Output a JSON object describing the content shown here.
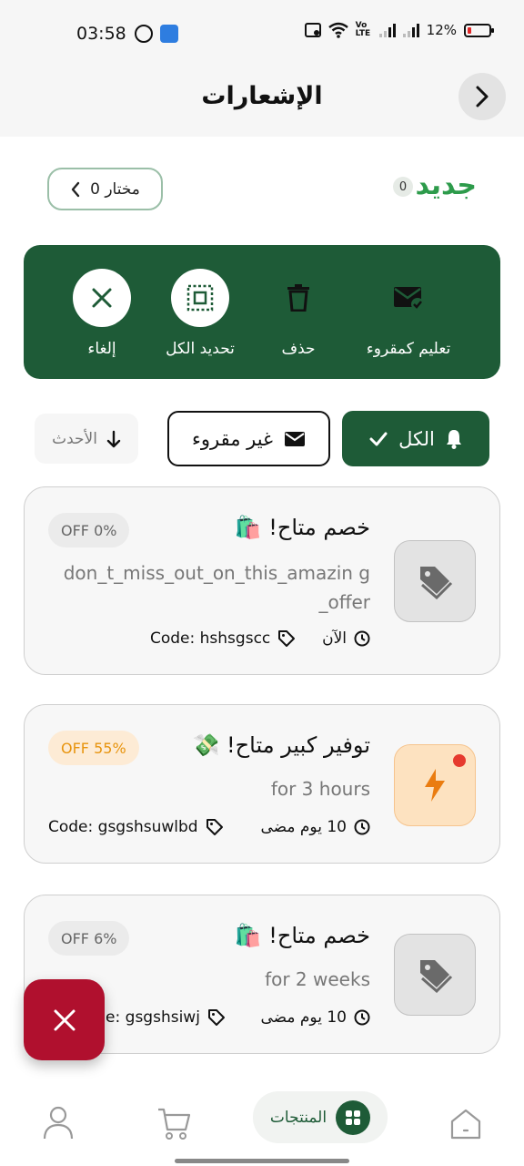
{
  "status_bar": {
    "time": "03:58",
    "battery": "12%",
    "volte": "Vo LTE"
  },
  "header": {
    "title": "الإشعارات"
  },
  "new_section": {
    "label": "جديد",
    "count": "0",
    "selected_label": "0 مختار"
  },
  "actions": {
    "mark_read": "تعليم كمقروء",
    "delete": "حذف",
    "select_all": "تحديد الكل",
    "cancel": "إلغاء"
  },
  "filters": {
    "all": "الكل",
    "unread": "غير مقروء",
    "sort": "الأحدث"
  },
  "notifications": [
    {
      "title": "خصم متاح! 🛍️",
      "body": "don_t_miss_out_on_this_amazin g_offer",
      "badge": "OFF 0%",
      "time": "الآن",
      "code": "Code: hshsgscc",
      "icon": "tag-icon",
      "badge_color": "#ebebeb"
    },
    {
      "title": "توفير كبير متاح! 💸",
      "body": "for 3 hours",
      "badge": "OFF 55%",
      "time": "10 يوم مضى",
      "code": "Code: gsgshsuwlbd",
      "icon": "lightning-icon",
      "badge_color": "#fdebd5",
      "unread": true
    },
    {
      "title": "خصم متاح! 🛍️",
      "body": "for 2 weeks",
      "badge": "OFF 6%",
      "time": "10 يوم مضى",
      "code": "Code: gsgshsiwj",
      "icon": "tag-icon",
      "badge_color": "#ebebeb"
    }
  ],
  "bottom_nav": {
    "products": "المنتجات"
  },
  "colors": {
    "primary": "#1e5b37",
    "accent_green": "#2d9b4b",
    "fab_red": "#b0102e",
    "orange": "#e8940e"
  }
}
